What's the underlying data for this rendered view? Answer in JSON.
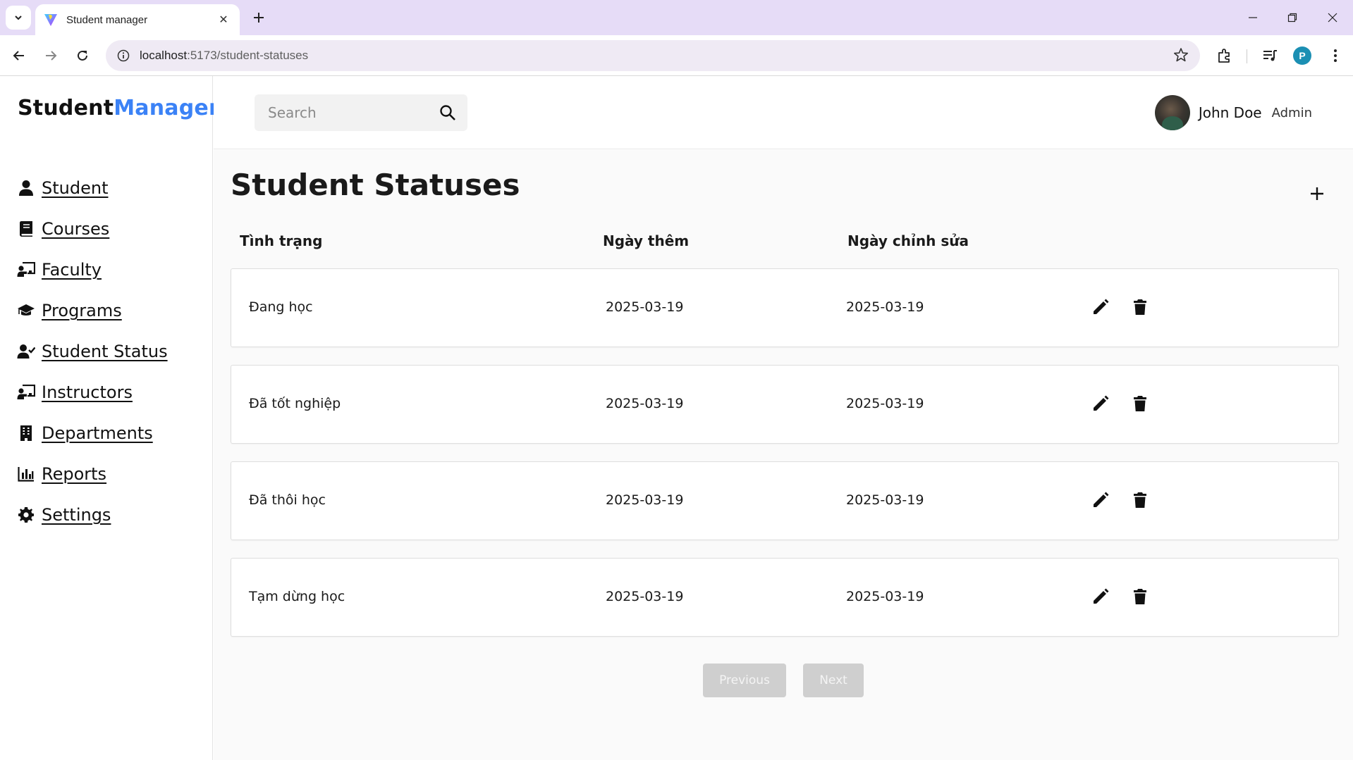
{
  "browser": {
    "tab_title": "Student manager",
    "url_host": "localhost",
    "url_path": ":5173/student-statuses",
    "profile_initial": "P"
  },
  "app": {
    "brand_part1": "Student",
    "brand_part2": "Manager",
    "brand_accent": "#3b82f6"
  },
  "sidebar": {
    "items": [
      {
        "label": "Student",
        "icon": "user-icon"
      },
      {
        "label": "Courses",
        "icon": "book-icon"
      },
      {
        "label": "Faculty",
        "icon": "chalkboard-teacher-icon"
      },
      {
        "label": "Programs",
        "icon": "graduation-cap-icon"
      },
      {
        "label": "Student Status",
        "icon": "user-check-icon"
      },
      {
        "label": "Instructors",
        "icon": "chalkboard-teacher-icon"
      },
      {
        "label": "Departments",
        "icon": "building-icon"
      },
      {
        "label": "Reports",
        "icon": "chart-bar-icon"
      },
      {
        "label": "Settings",
        "icon": "gear-icon"
      }
    ]
  },
  "header": {
    "search_placeholder": "Search",
    "user_name": "John Doe",
    "user_role": "Admin"
  },
  "main": {
    "title": "Student Statuses",
    "columns": [
      "Tình trạng",
      "Ngày thêm",
      "Ngày chỉnh sửa"
    ],
    "rows": [
      {
        "status": "Đang học",
        "created": "2025-03-19",
        "updated": "2025-03-19"
      },
      {
        "status": "Đã tốt nghiệp",
        "created": "2025-03-19",
        "updated": "2025-03-19"
      },
      {
        "status": "Đã thôi học",
        "created": "2025-03-19",
        "updated": "2025-03-19"
      },
      {
        "status": "Tạm dừng học",
        "created": "2025-03-19",
        "updated": "2025-03-19"
      }
    ],
    "pagination": {
      "previous": "Previous",
      "next": "Next"
    }
  }
}
